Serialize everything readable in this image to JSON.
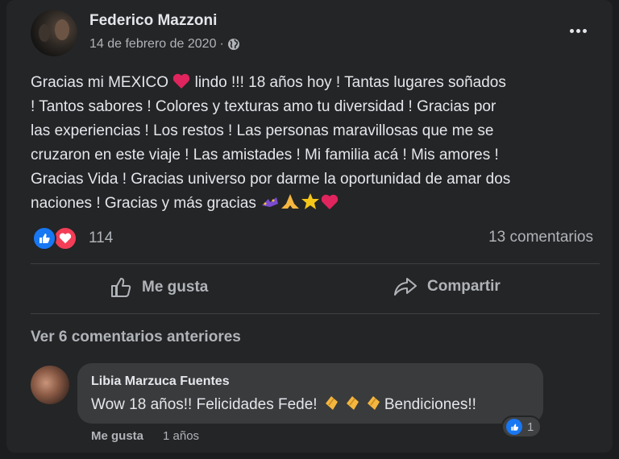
{
  "post": {
    "author": "Federico Mazzoni",
    "date": "14 de febrero de 2020",
    "separator": "·",
    "privacy_icon": "globe-icon",
    "more_icon": "more-options-icon",
    "lines": [
      "Gracias mi  MEXICO ",
      " lindo !!! 18 años hoy !  Tantas lugares soñados",
      "! Tantos sabores ! Colores y texturas amo tu diversidad !  Gracias por",
      "las experiencias ! Los restos ! Las personas maravillosas que me se",
      "cruzaron en este viaje ! Las amistades ! Mi familia acá ! Mis amores !",
      "Gracias Vida ! Gracias  universo por darme la oportunidad de amar dos",
      "naciones  ! Gracias y más gracias "
    ]
  },
  "reactions": {
    "count": "114",
    "comments_count": "13 comentarios",
    "like_color": "#1877f2",
    "love_color": "#f33e58"
  },
  "actions": {
    "like_label": "Me gusta",
    "share_label": "Compartir"
  },
  "comments": {
    "view_previous": "Ver 6 comentarios anteriores",
    "items": [
      {
        "author": "Libia Marzuca Fuentes",
        "text_start": "Wow 18 años!! Felicidades Fede! ",
        "text_end": "Bendiciones!!",
        "reaction_count": "1",
        "like_label": "Me gusta",
        "time": "1 años"
      }
    ]
  }
}
